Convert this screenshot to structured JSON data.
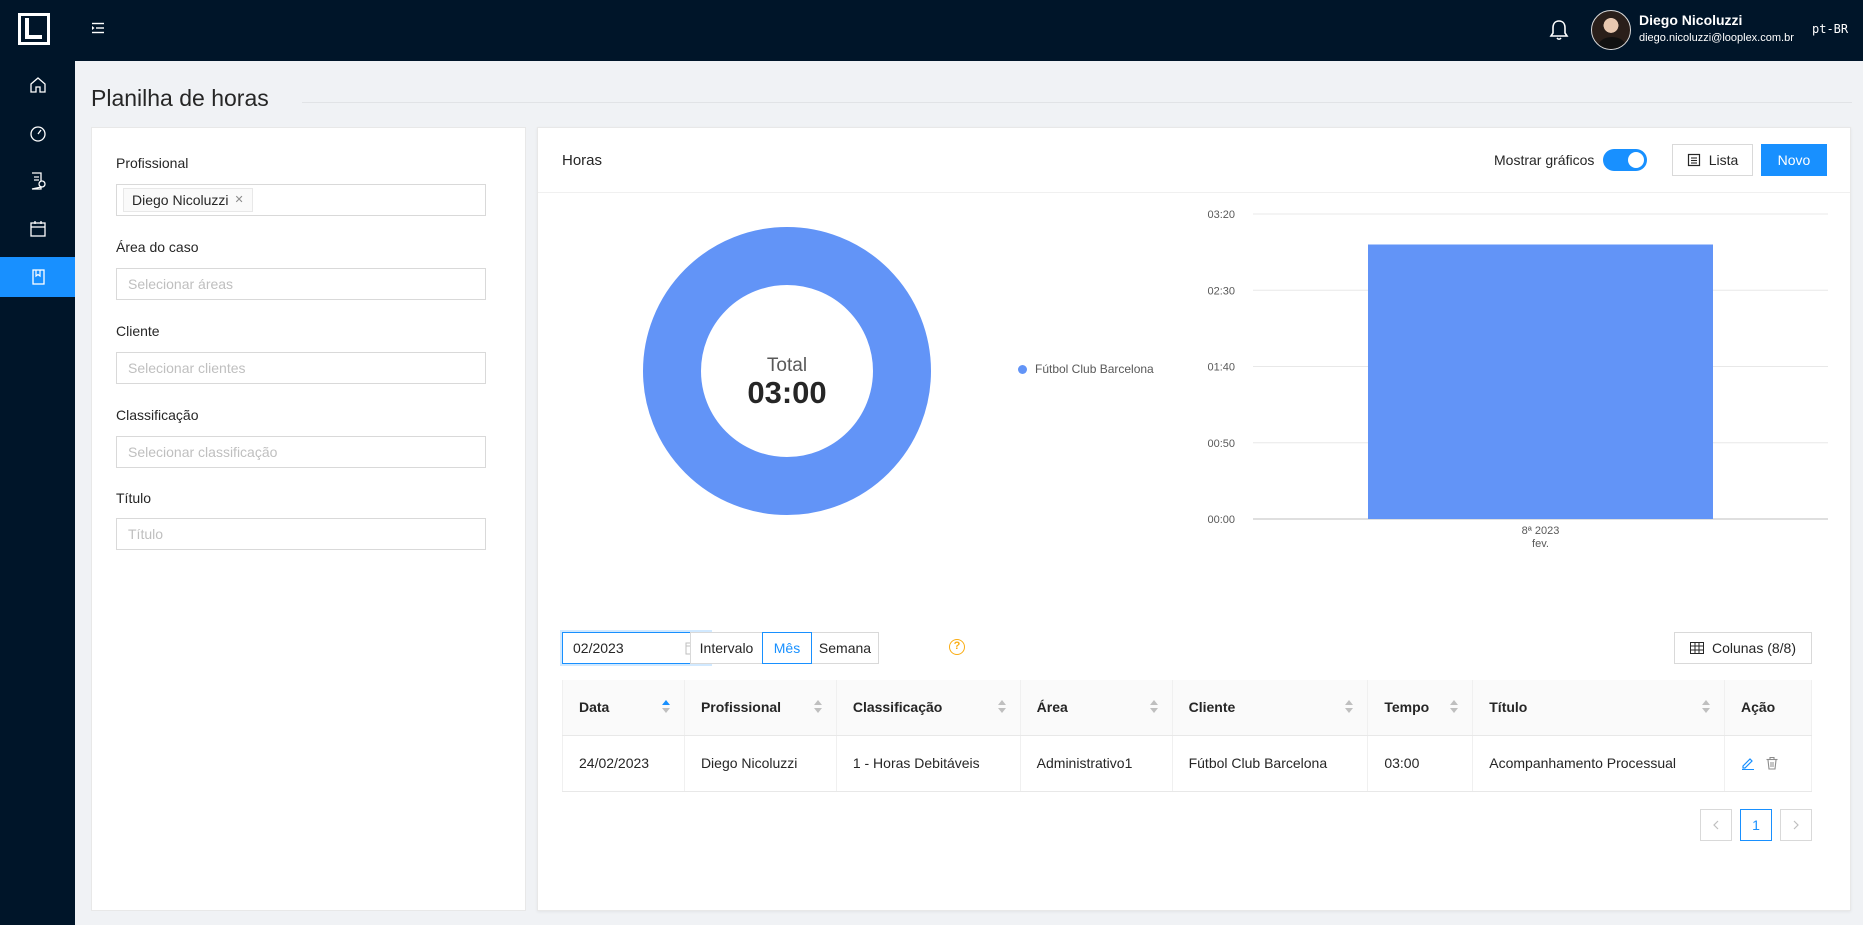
{
  "user": {
    "name": "Diego Nicoluzzi",
    "email": "diego.nicoluzzi@looplex.com.br",
    "language": "pt-BR"
  },
  "sidebar": {
    "items": [
      "home-icon",
      "dashboard-icon",
      "document-settings-icon",
      "calendar-icon",
      "timesheet-icon"
    ],
    "active_index": 4
  },
  "page": {
    "title": "Planilha de horas"
  },
  "filters": {
    "professional": {
      "label": "Profissional",
      "selected_tag": "Diego Nicoluzzi"
    },
    "case_area": {
      "label": "Área do caso",
      "placeholder": "Selecionar áreas"
    },
    "client": {
      "label": "Cliente",
      "placeholder": "Selecionar clientes"
    },
    "classification": {
      "label": "Classificação",
      "placeholder": "Selecionar classificação"
    },
    "title": {
      "label": "Título",
      "placeholder": "Título"
    }
  },
  "card": {
    "title": "Horas",
    "show_charts_label": "Mostrar gráficos",
    "show_charts_on": true,
    "list_button": "Lista",
    "new_button": "Novo",
    "accent_color": "#1890ff"
  },
  "chart_data": [
    {
      "type": "pie",
      "center_label": "Total",
      "center_value": "03:00",
      "slices": [
        {
          "name": "Fútbol Club Barcelona",
          "value": 180,
          "color": "#6294f7"
        }
      ]
    },
    {
      "type": "bar",
      "categories": [
        "8ª 2023"
      ],
      "category_sublabels": [
        "fev."
      ],
      "values": [
        180
      ],
      "y_ticks": [
        "00:00",
        "00:50",
        "01:40",
        "02:30",
        "03:20"
      ],
      "ylim": [
        0,
        200
      ],
      "grid": true,
      "color": "#6294f7"
    }
  ],
  "controls": {
    "date_value": "02/2023",
    "segments": [
      "Intervalo",
      "Mês",
      "Semana"
    ],
    "active_segment": "Mês",
    "columns_button": "Colunas (8/8)"
  },
  "table": {
    "headers": [
      "Data",
      "Profissional",
      "Classificação",
      "Área",
      "Cliente",
      "Tempo",
      "Título",
      "Ação"
    ],
    "rows": [
      [
        "24/02/2023",
        "Diego Nicoluzzi",
        "1 - Horas Debitáveis",
        "Administrativo1",
        "Fútbol Club Barcelona",
        "03:00",
        "Acompanhamento Processual"
      ]
    ]
  },
  "pagination": {
    "current_page": "1"
  }
}
